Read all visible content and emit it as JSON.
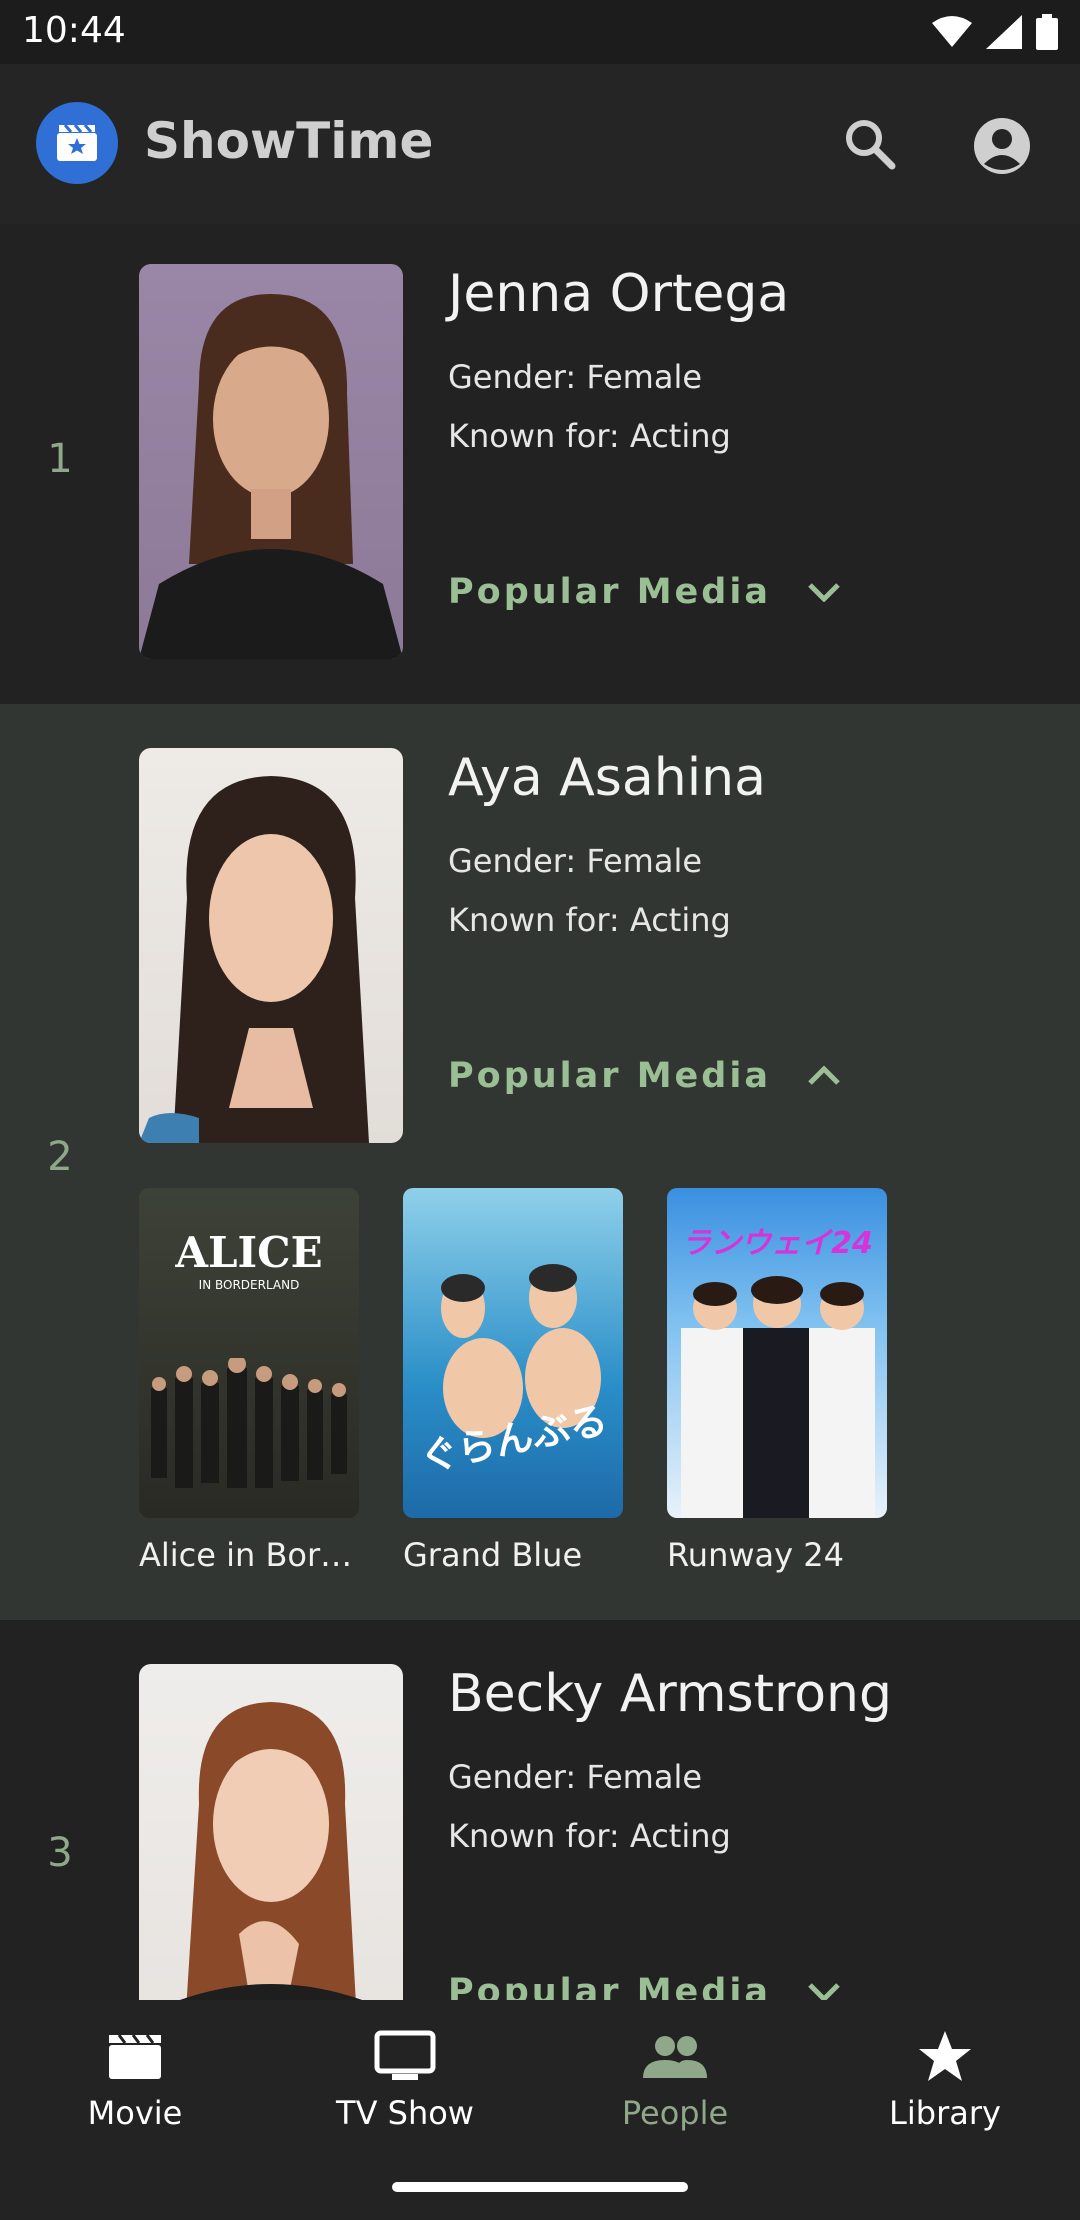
{
  "status_bar": {
    "time": "10:44"
  },
  "app_bar": {
    "title": "ShowTime",
    "logo_icon": "movie-clapper-icon",
    "search_icon": "search-icon",
    "account_icon": "account-circle-icon"
  },
  "people": [
    {
      "rank": "1",
      "name": "Jenna Ortega",
      "gender": "Gender: Female",
      "known_for": "Known for: Acting",
      "popular_label": "Popular Media",
      "expanded": false
    },
    {
      "rank": "2",
      "name": "Aya Asahina",
      "gender": "Gender: Female",
      "known_for": "Known for: Acting",
      "popular_label": "Popular Media",
      "expanded": true,
      "media": [
        {
          "title": "Alice in Bor…",
          "poster_text": "ALICE",
          "poster_sub": "IN BORDERLAND"
        },
        {
          "title": "Grand Blue",
          "poster_text": "ぐらんぶる",
          "poster_sub": ""
        },
        {
          "title": "Runway 24",
          "poster_text": "ランウェイ24",
          "poster_sub": ""
        }
      ]
    },
    {
      "rank": "3",
      "name": "Becky Armstrong",
      "gender": "Gender: Female",
      "known_for": "Known for: Acting",
      "popular_label": "Popular Media",
      "expanded": false
    }
  ],
  "bottom_nav": [
    {
      "label": "Movie",
      "icon": "movie-icon",
      "active": false
    },
    {
      "label": "TV Show",
      "icon": "tv-icon",
      "active": false
    },
    {
      "label": "People",
      "icon": "people-icon",
      "active": true
    },
    {
      "label": "Library",
      "icon": "star-icon",
      "active": false
    }
  ],
  "colors": {
    "accent": "#8fa88a",
    "background": "#222222",
    "expanded_bg": "#323632",
    "logo": "#2f6fd6"
  }
}
